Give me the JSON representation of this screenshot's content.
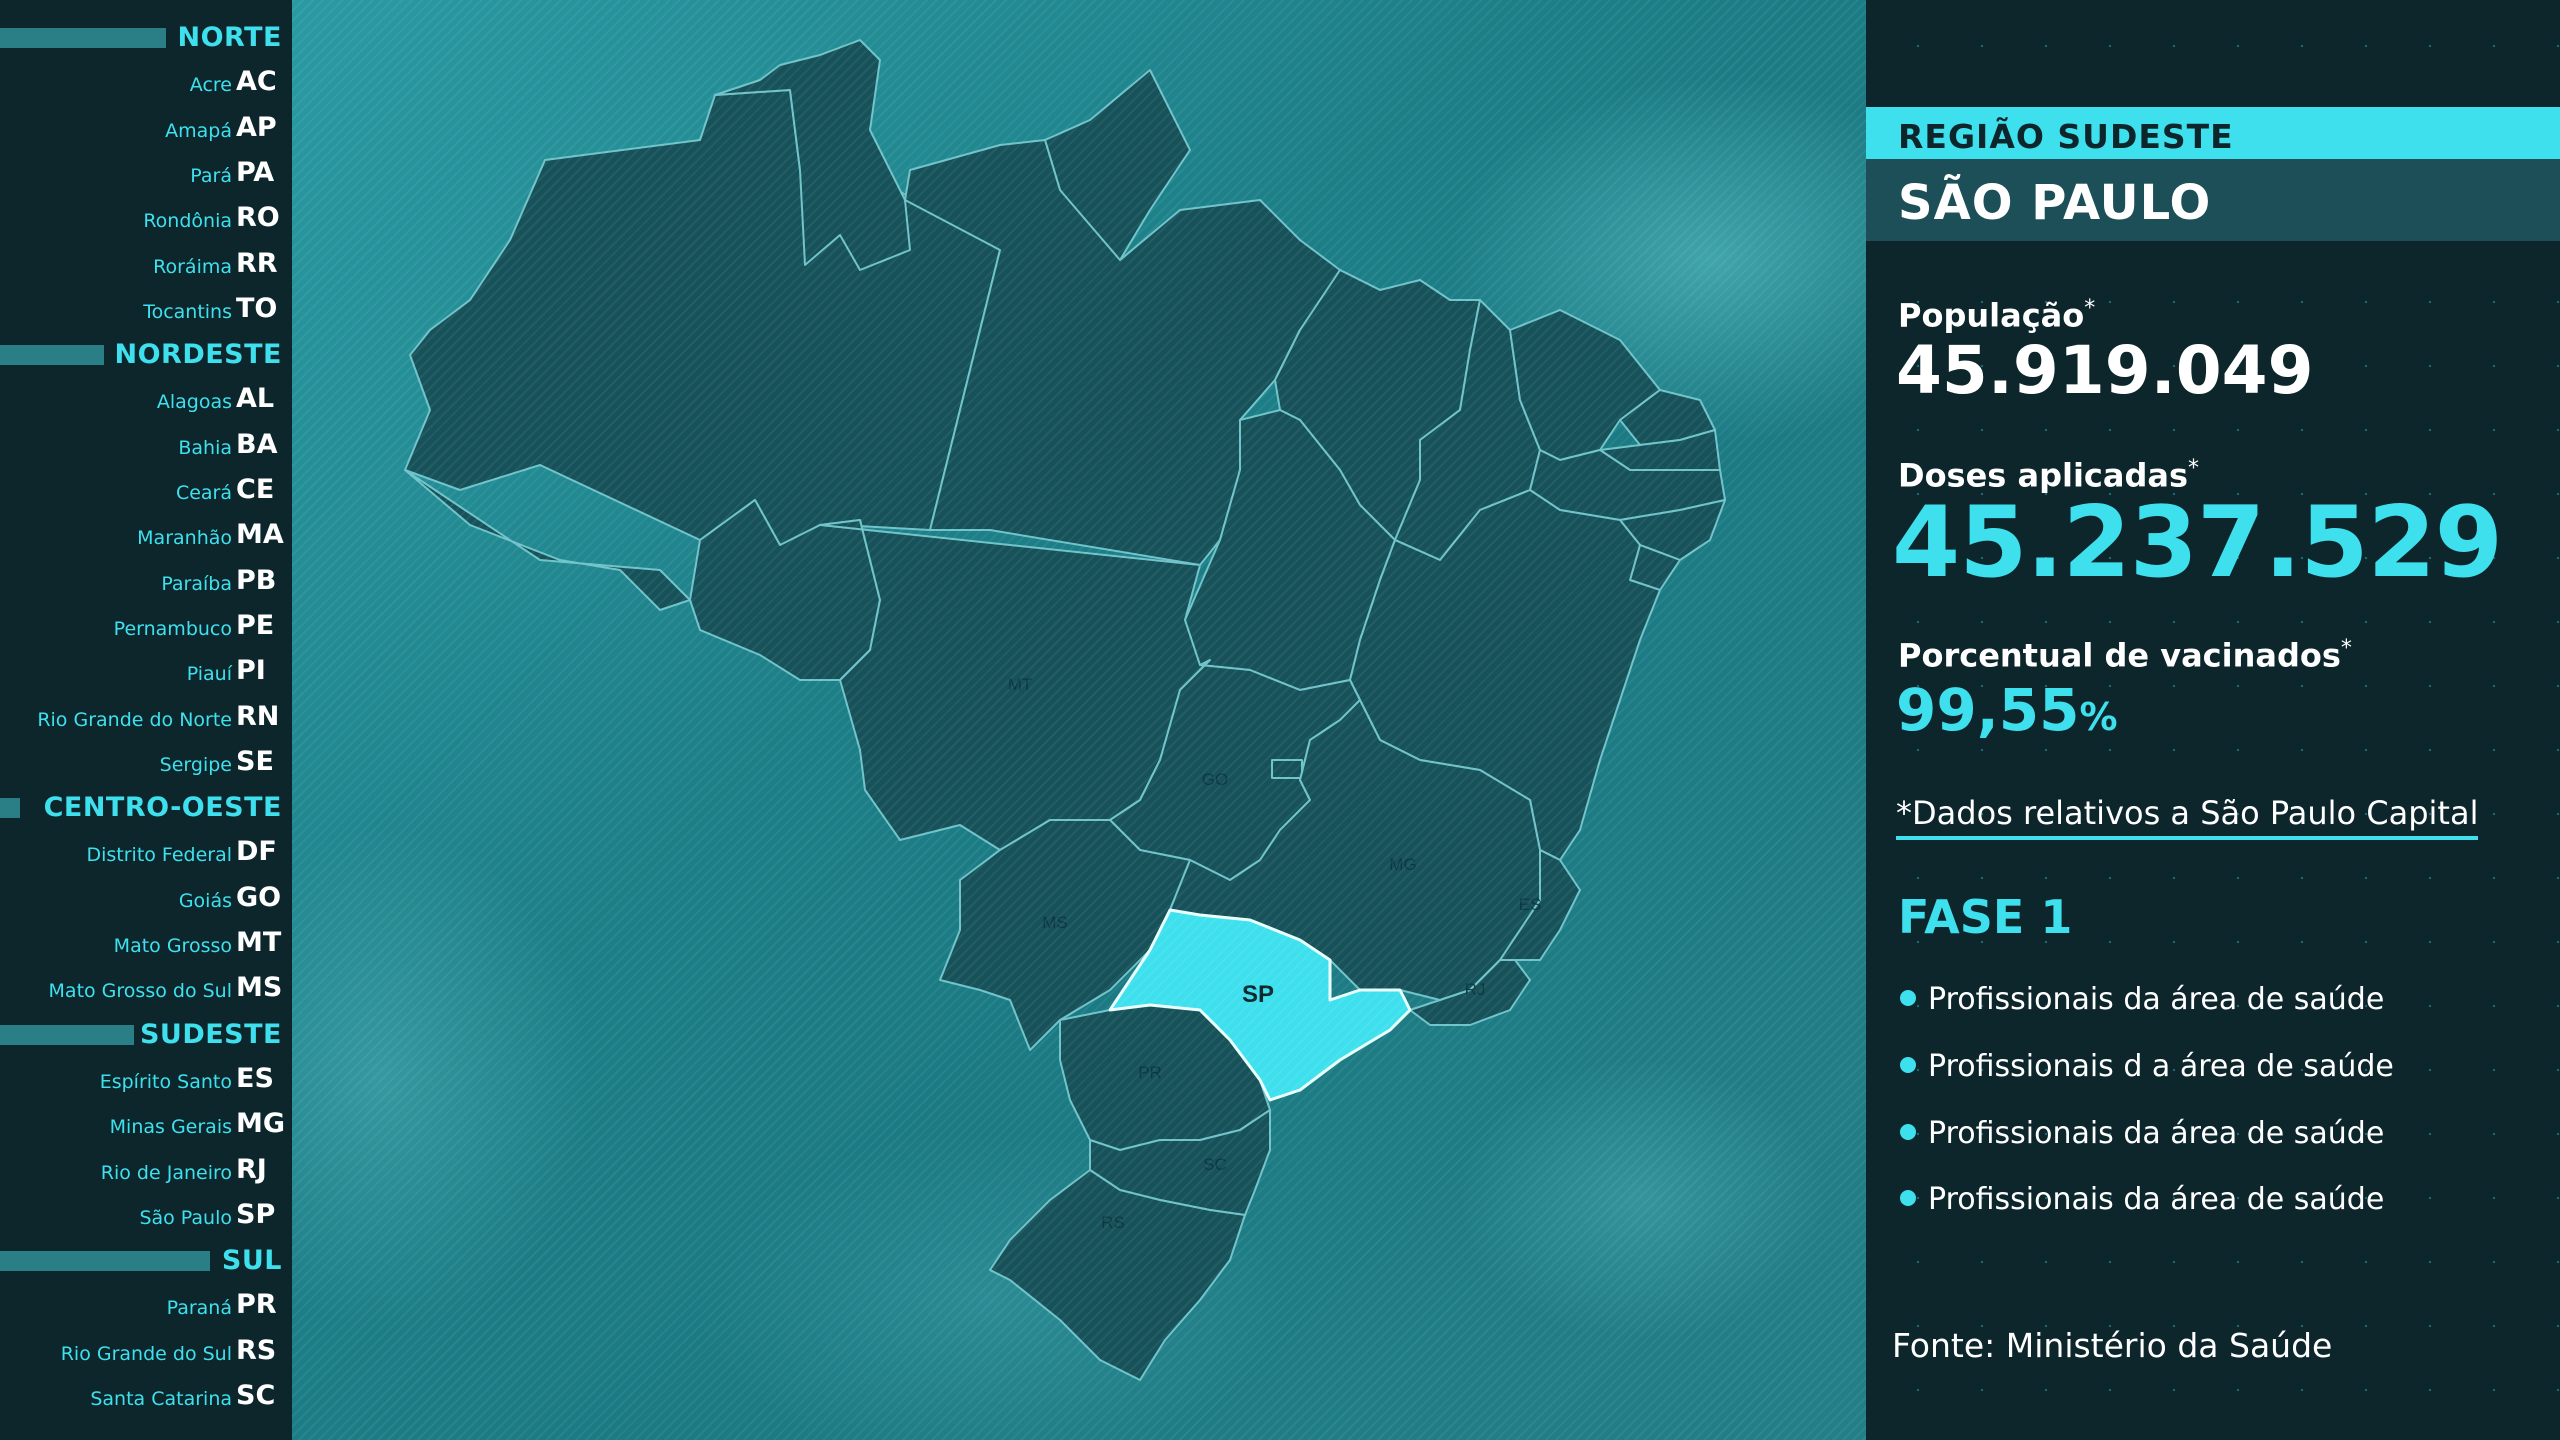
{
  "regions": [
    {
      "name": "NORTE",
      "states": [
        {
          "name": "Acre",
          "code": "AC"
        },
        {
          "name": "Amapá",
          "code": "AP"
        },
        {
          "name": "Pará",
          "code": "PA"
        },
        {
          "name": "Rondônia",
          "code": "RO"
        },
        {
          "name": "Roráima",
          "code": "RR"
        },
        {
          "name": "Tocantins",
          "code": "TO"
        }
      ]
    },
    {
      "name": "NORDESTE",
      "states": [
        {
          "name": "Alagoas",
          "code": "AL"
        },
        {
          "name": "Bahia",
          "code": "BA"
        },
        {
          "name": "Ceará",
          "code": "CE"
        },
        {
          "name": "Maranhão",
          "code": "MA"
        },
        {
          "name": "Paraíba",
          "code": "PB"
        },
        {
          "name": "Pernambuco",
          "code": "PE"
        },
        {
          "name": "Piauí",
          "code": "PI"
        },
        {
          "name": "Rio Grande do Norte",
          "code": "RN"
        },
        {
          "name": "Sergipe",
          "code": "SE"
        }
      ]
    },
    {
      "name": "CENTRO-OESTE",
      "states": [
        {
          "name": "Distrito Federal",
          "code": "DF"
        },
        {
          "name": "Goiás",
          "code": "GO"
        },
        {
          "name": "Mato Grosso",
          "code": "MT"
        },
        {
          "name": "Mato Grosso do Sul",
          "code": "MS"
        }
      ]
    },
    {
      "name": "SUDESTE",
      "states": [
        {
          "name": "Espírito Santo",
          "code": "ES"
        },
        {
          "name": "Minas Gerais",
          "code": "MG"
        },
        {
          "name": "Rio de Janeiro",
          "code": "RJ"
        },
        {
          "name": "São Paulo",
          "code": "SP"
        }
      ]
    },
    {
      "name": "SUL",
      "states": [
        {
          "name": "Paraná",
          "code": "PR"
        },
        {
          "name": "Rio Grande do Sul",
          "code": "RS"
        },
        {
          "name": "Santa Catarina",
          "code": "SC"
        }
      ]
    }
  ],
  "map": {
    "highlighted_state": "SP",
    "labels": {
      "sp": "SP",
      "mt": "MT",
      "go": "GO",
      "ms": "MS",
      "mg": "MG",
      "es": "ES",
      "rj": "RJ",
      "pr": "PR",
      "sc": "SC",
      "rs": "RS"
    },
    "colors": {
      "highlight": "#3fe0ee",
      "state_fill": "#17525a",
      "border": "#6fc3c9"
    }
  },
  "panel": {
    "region_title": "REGIÃO SUDESTE",
    "state_title": "SÃO PAULO",
    "population_label": "População",
    "population_value": "45.919.049",
    "doses_label": "Doses aplicadas",
    "doses_value": "45.237.529",
    "percent_label": "Porcentual de vacinados",
    "percent_value": "99,55",
    "percent_unit": "%",
    "asterisk": "*",
    "note": "*Dados relativos a São Paulo Capital",
    "phase_title": "FASE 1",
    "phase_items": [
      "Profissionais da área de saúde",
      "Profissionais d a área de saúde",
      "Profissionais da área de saúde",
      "Profissionais da área de saúde"
    ],
    "source": "Fonte: Ministério da Saúde"
  }
}
